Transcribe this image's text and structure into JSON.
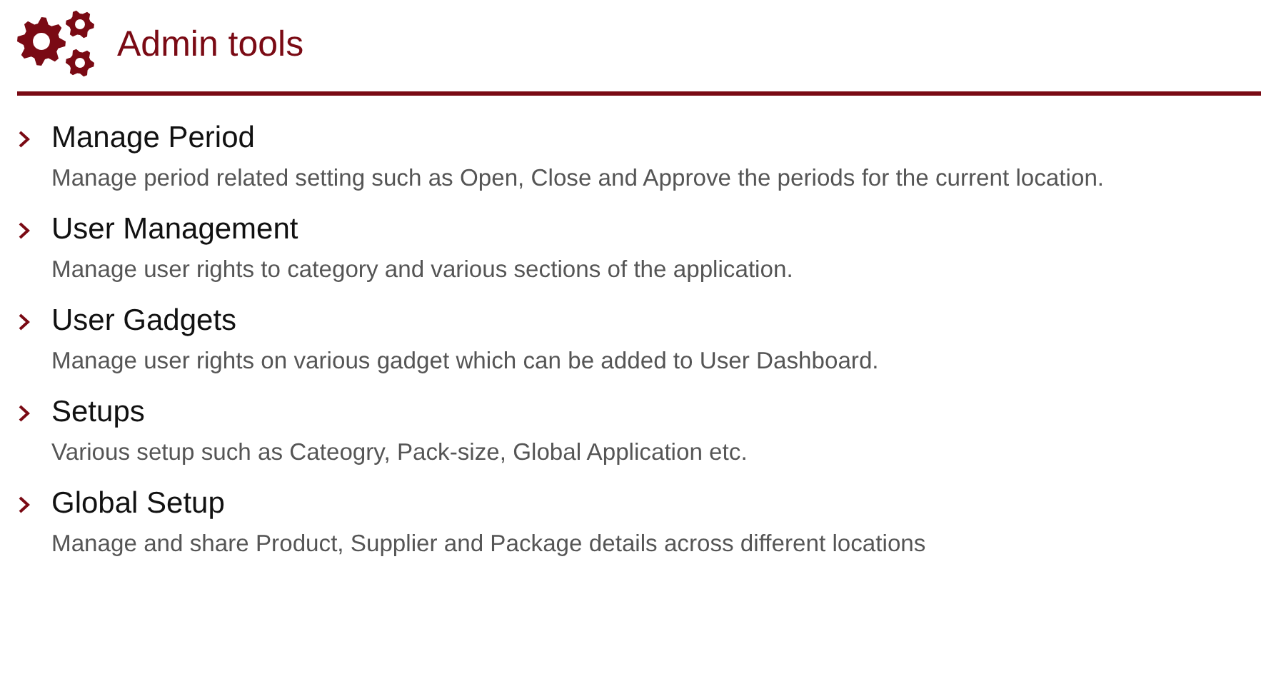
{
  "header": {
    "title": "Admin tools"
  },
  "items": [
    {
      "title": "Manage Period",
      "description": "Manage period related setting such as Open, Close and Approve the periods for the current location."
    },
    {
      "title": "User Management",
      "description": "Manage user rights to category and various sections of the application."
    },
    {
      "title": "User Gadgets",
      "description": "Manage user rights on various gadget which can be added to User Dashboard."
    },
    {
      "title": "Setups",
      "description": "Various setup such as Cateogry, Pack-size, Global Application etc."
    },
    {
      "title": "Global Setup",
      "description": "Manage and share Product, Supplier and Package details across different locations"
    }
  ]
}
